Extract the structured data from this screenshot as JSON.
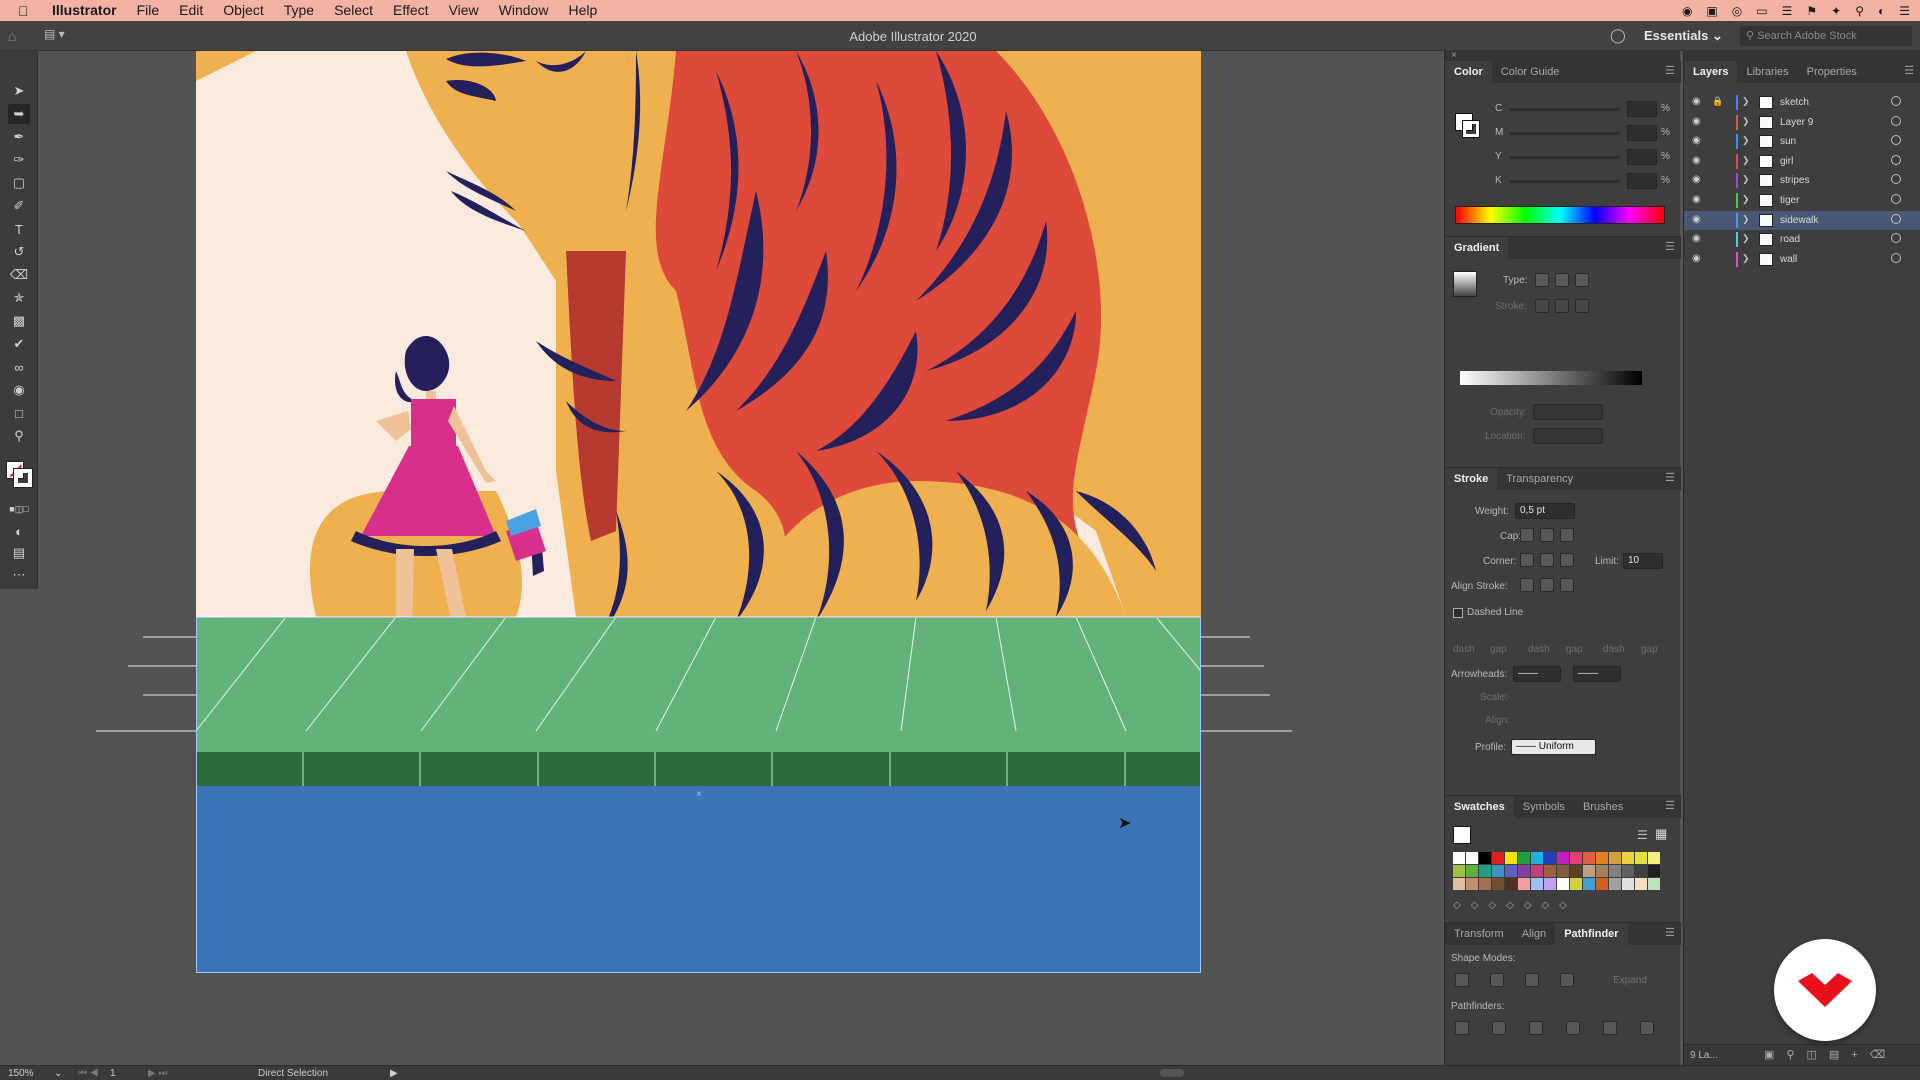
{
  "menubar": {
    "app": "Illustrator",
    "items": [
      "File",
      "Edit",
      "Object",
      "Type",
      "Select",
      "Effect",
      "View",
      "Window",
      "Help"
    ]
  },
  "appbar": {
    "title": "Adobe Illustrator 2020",
    "workspace": "Essentials",
    "search_placeholder": "Search Adobe Stock"
  },
  "color_panel": {
    "tabs": [
      "Color",
      "Color Guide"
    ],
    "channels": [
      "C",
      "M",
      "Y",
      "K"
    ],
    "unit": "%"
  },
  "gradient_panel": {
    "tab": "Gradient",
    "type_label": "Type:",
    "stroke_label": "Stroke:",
    "opacity_label": "Opacity:",
    "location_label": "Location:"
  },
  "stroke_panel": {
    "tabs": [
      "Stroke",
      "Transparency"
    ],
    "weight_label": "Weight:",
    "weight_value": "0,5 pt",
    "cap_label": "Cap:",
    "corner_label": "Corner:",
    "limit_label": "Limit:",
    "limit_value": "10",
    "align_label": "Align Stroke:",
    "dashed_label": "Dashed Line",
    "dash_labels": [
      "dash",
      "gap",
      "dash",
      "gap",
      "dash",
      "gap"
    ],
    "arrowheads_label": "Arrowheads:",
    "scale_label": "Scale:",
    "align2_label": "Align:",
    "profile_label": "Profile:",
    "profile_value": "Uniform"
  },
  "swatches_panel": {
    "tabs": [
      "Swatches",
      "Symbols",
      "Brushes"
    ]
  },
  "pathfinder_panel": {
    "tabs": [
      "Transform",
      "Align",
      "Pathfinder"
    ],
    "shape_modes_label": "Shape Modes:",
    "expand_label": "Expand",
    "pathfinders_label": "Pathfinders:"
  },
  "layers_panel": {
    "tabs": [
      "Layers",
      "Libraries",
      "Properties"
    ],
    "layers": [
      {
        "name": "sketch",
        "color": "#4f7bff",
        "locked": true
      },
      {
        "name": "Layer 9",
        "color": "#e05a3c",
        "locked": false
      },
      {
        "name": "sun",
        "color": "#3c8cff",
        "locked": false
      },
      {
        "name": "girl",
        "color": "#e04a4a",
        "locked": false
      },
      {
        "name": "stripes",
        "color": "#9a4ae0",
        "locked": false
      },
      {
        "name": "tiger",
        "color": "#4ac85a",
        "locked": false
      },
      {
        "name": "sidewalk",
        "color": "#4a9ae0",
        "locked": false,
        "selected": true
      },
      {
        "name": "road",
        "color": "#4ad0e0",
        "locked": false
      },
      {
        "name": "wall",
        "color": "#e04ad8",
        "locked": false
      }
    ],
    "count_label": "9 La..."
  },
  "status": {
    "zoom": "150%",
    "page": "1",
    "tool": "Direct Selection"
  },
  "colors": {
    "orange": "#efb050",
    "red_tiger": "#de4a3a",
    "navy": "#24205c",
    "cream": "#fbebdf",
    "pink": "#d8308a",
    "green_sidewalk": "#62b27a",
    "green_dark": "#2d6b3d",
    "blue_road": "#3b75b6"
  }
}
